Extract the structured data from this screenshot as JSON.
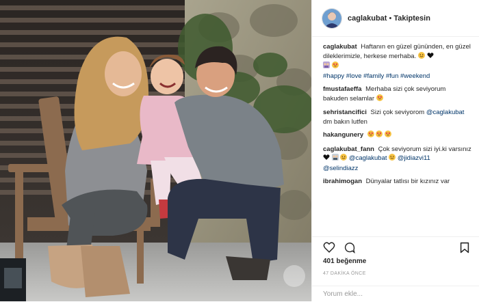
{
  "header": {
    "username": "caglakubat",
    "separator": "•",
    "follow_status": "Takiptesin",
    "avatar_icon": "profile-avatar-icon"
  },
  "comments": [
    {
      "user": "caglakubat",
      "text": "Haftanın en güzel gününden, en güzel dileklerimizle, herkese merhaba.",
      "hashtags": "#happy #love #family #fun #weekend"
    },
    {
      "user": "fmustafaeffa",
      "text": "Merhaba sizi çok seviyorum bakuden selamlar"
    },
    {
      "user": "sehristancifici",
      "text": "Sizi çok seviyorom",
      "mention": "@caglakubat",
      "text2": "dm bakın lutfen"
    },
    {
      "user": "hakangunery",
      "text": ""
    },
    {
      "user": "caglakubat_fann",
      "text": "Çok seviyorum sizi iyi.ki varsınız",
      "mention": "@caglakubat",
      "mention2": "@jidiazvi11",
      "mention3": "@selindiazz"
    },
    {
      "user": "ibrahimogan",
      "text": "Dünyalar tatlısı bir kızınız var"
    }
  ],
  "actions": {
    "like_icon": "heart-icon",
    "comment_icon": "comment-bubble-icon",
    "save_icon": "bookmark-icon"
  },
  "likes": "401 beğenme",
  "time": "47 DAKİKA ÖNCE",
  "add_comment": {
    "placeholder": "Yorum ekle..."
  },
  "colors": {
    "link": "#003569",
    "text": "#262626",
    "muted": "#999999",
    "border": "#efefef"
  }
}
